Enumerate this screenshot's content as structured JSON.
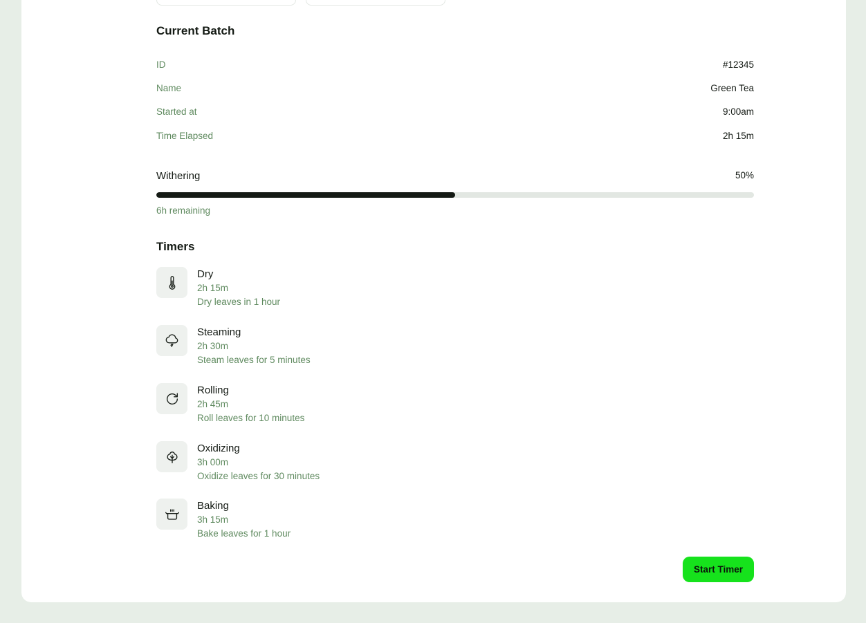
{
  "batch": {
    "title": "Current Batch",
    "rows": [
      {
        "label": "ID",
        "value": "#12345"
      },
      {
        "label": "Name",
        "value": "Green Tea"
      },
      {
        "label": "Started at",
        "value": "9:00am"
      },
      {
        "label": "Time Elapsed",
        "value": "2h 15m"
      }
    ]
  },
  "progress": {
    "stage": "Withering",
    "percent_label": "50%",
    "fraction": 0.5,
    "remaining": "6h remaining"
  },
  "timers": {
    "title": "Timers",
    "items": [
      {
        "icon": "thermometer-icon",
        "name": "Dry",
        "time": "2h 15m",
        "description": "Dry leaves in 1 hour"
      },
      {
        "icon": "cloud-drizzle-icon",
        "name": "Steaming",
        "time": "2h 30m",
        "description": "Steam leaves for 5 minutes"
      },
      {
        "icon": "rotate-cw-icon",
        "name": "Rolling",
        "time": "2h 45m",
        "description": "Roll leaves for 10 minutes"
      },
      {
        "icon": "tree-icon",
        "name": "Oxidizing",
        "time": "3h 00m",
        "description": "Oxidize leaves for 30 minutes"
      },
      {
        "icon": "cooking-pot-icon",
        "name": "Baking",
        "time": "3h 15m",
        "description": "Bake leaves for 1 hour"
      }
    ]
  },
  "actions": {
    "start_timer_label": "Start Timer"
  },
  "colors": {
    "accent": "#16e21c",
    "muted_text": "#5f8a5f",
    "page_background": "#e7eee7"
  }
}
